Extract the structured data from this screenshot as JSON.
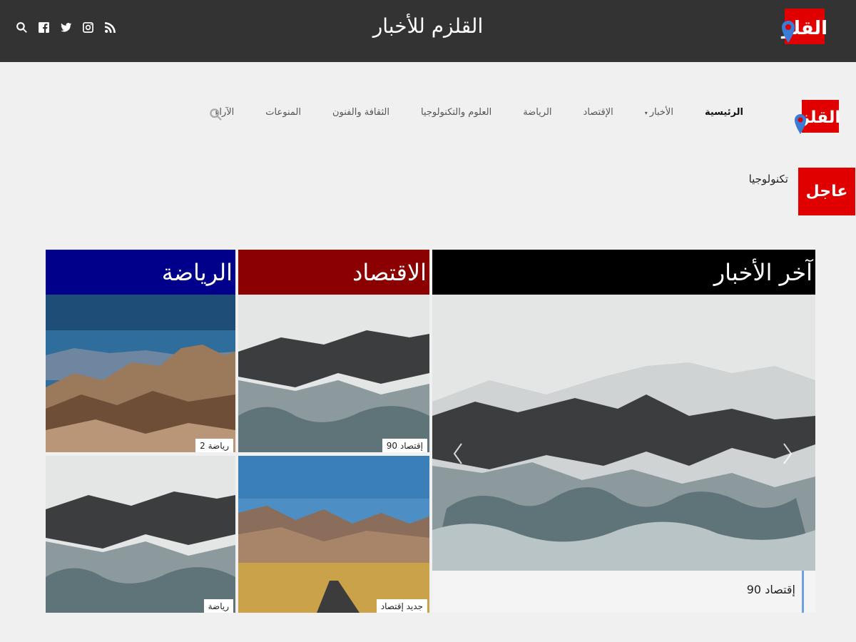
{
  "header": {
    "site_title": "القلزم للأخبار",
    "logo_text": "القلزم",
    "social_icons": [
      "rss-icon",
      "instagram-icon",
      "twitter-icon",
      "facebook-icon",
      "search-icon"
    ]
  },
  "nav": {
    "logo_text": "القلزم",
    "items": [
      {
        "label": "الرئيسية",
        "active": true
      },
      {
        "label": "الأخبار",
        "dropdown": true
      },
      {
        "label": "الإقتصاد"
      },
      {
        "label": "الرياضة"
      },
      {
        "label": "العلوم والتكنولوجيا"
      },
      {
        "label": "الثقافة والفنون"
      },
      {
        "label": "المنوعات"
      },
      {
        "label": "الآراء"
      }
    ],
    "caret": "▾"
  },
  "breaking": {
    "label": "عاجل",
    "text": "تكنولوجيا"
  },
  "sections": {
    "latest": {
      "title": "آخر الأخبار",
      "color": "#000000",
      "caption": "إقتصاد 90"
    },
    "economy": {
      "title": "الاقتصاد",
      "color": "#8b0000",
      "tiles": [
        "إقتصاد 90",
        "جديد إقتصاد"
      ]
    },
    "sports": {
      "title": "الرياضة",
      "color": "#00008b",
      "tiles": [
        "رياضة 2",
        "رياضة"
      ]
    }
  },
  "colors": {
    "accent_red": "#e00000",
    "topbar": "#333333",
    "caption_bar": "#6aa3e0"
  }
}
